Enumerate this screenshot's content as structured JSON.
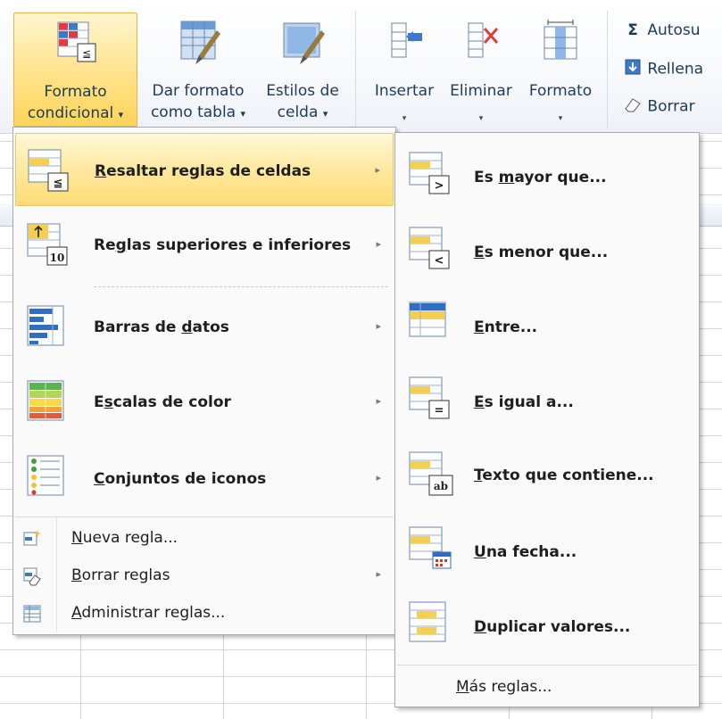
{
  "ribbon": {
    "formato_condicional": {
      "line1": "Formato",
      "line2": "condicional",
      "caret": "▾"
    },
    "dar_formato_tabla": {
      "line1": "Dar formato",
      "line2": "como tabla",
      "caret": "▾"
    },
    "estilos_celda": {
      "line1": "Estilos de",
      "line2": "celda",
      "caret": "▾"
    },
    "insertar": {
      "label": "Insertar",
      "caret": "▾"
    },
    "eliminar": {
      "label": "Eliminar",
      "caret": "▾"
    },
    "formato": {
      "label": "Formato",
      "caret": "▾"
    },
    "autosuma": "Autosu",
    "rellenar": "Rellena",
    "borrar": "Borrar"
  },
  "main_menu": {
    "items": [
      {
        "label": "Resaltar reglas de celdas",
        "mnemonic": "R",
        "rest": "esaltar reglas de celdas",
        "icon": "highlight-cells-rules-icon"
      },
      {
        "label": "Reglas superiores e inferiores",
        "pre": "Re",
        "mnemonic": "g",
        "rest": "las superiores e inferiores",
        "icon": "top-bottom-rules-icon"
      },
      {
        "label": "Barras de datos",
        "pre": "Barras de ",
        "mnemonic": "d",
        "rest": "atos",
        "icon": "data-bars-icon"
      },
      {
        "label": "Escalas de color",
        "pre": "E",
        "mnemonic": "s",
        "rest": "calas de color",
        "icon": "color-scales-icon"
      },
      {
        "label": "Conjuntos de iconos",
        "pre": "",
        "mnemonic": "C",
        "rest": "onjuntos de iconos",
        "icon": "icon-sets-icon"
      }
    ],
    "actions": [
      {
        "pre": "",
        "mnemonic": "N",
        "rest": "ueva regla...",
        "icon": "new-rule-icon"
      },
      {
        "pre": "",
        "mnemonic": "B",
        "rest": "orrar reglas",
        "icon": "clear-rules-icon"
      },
      {
        "pre": "",
        "mnemonic": "A",
        "rest": "dministrar reglas...",
        "icon": "manage-rules-icon"
      }
    ],
    "arrow": "▸"
  },
  "sub_menu": {
    "items": [
      {
        "pre": "Es ",
        "mnemonic": "m",
        "rest": "ayor que...",
        "icon": "greater-than-icon"
      },
      {
        "pre": "",
        "mnemonic": "E",
        "rest": "s menor que...",
        "icon": "less-than-icon"
      },
      {
        "pre": "",
        "mnemonic": "E",
        "rest": "ntre...",
        "icon": "between-icon"
      },
      {
        "pre": "",
        "mnemonic": "E",
        "rest": "s igual a...",
        "icon": "equal-to-icon"
      },
      {
        "pre": "",
        "mnemonic": "T",
        "rest": "exto que contiene...",
        "icon": "text-contains-icon"
      },
      {
        "pre": "",
        "mnemonic": "U",
        "rest": "na fecha...",
        "icon": "date-occurring-icon"
      },
      {
        "pre": "",
        "mnemonic": "D",
        "rest": "uplicar valores...",
        "icon": "duplicate-values-icon"
      }
    ],
    "more": {
      "pre": "",
      "mnemonic": "M",
      "rest": "ás reglas..."
    }
  }
}
